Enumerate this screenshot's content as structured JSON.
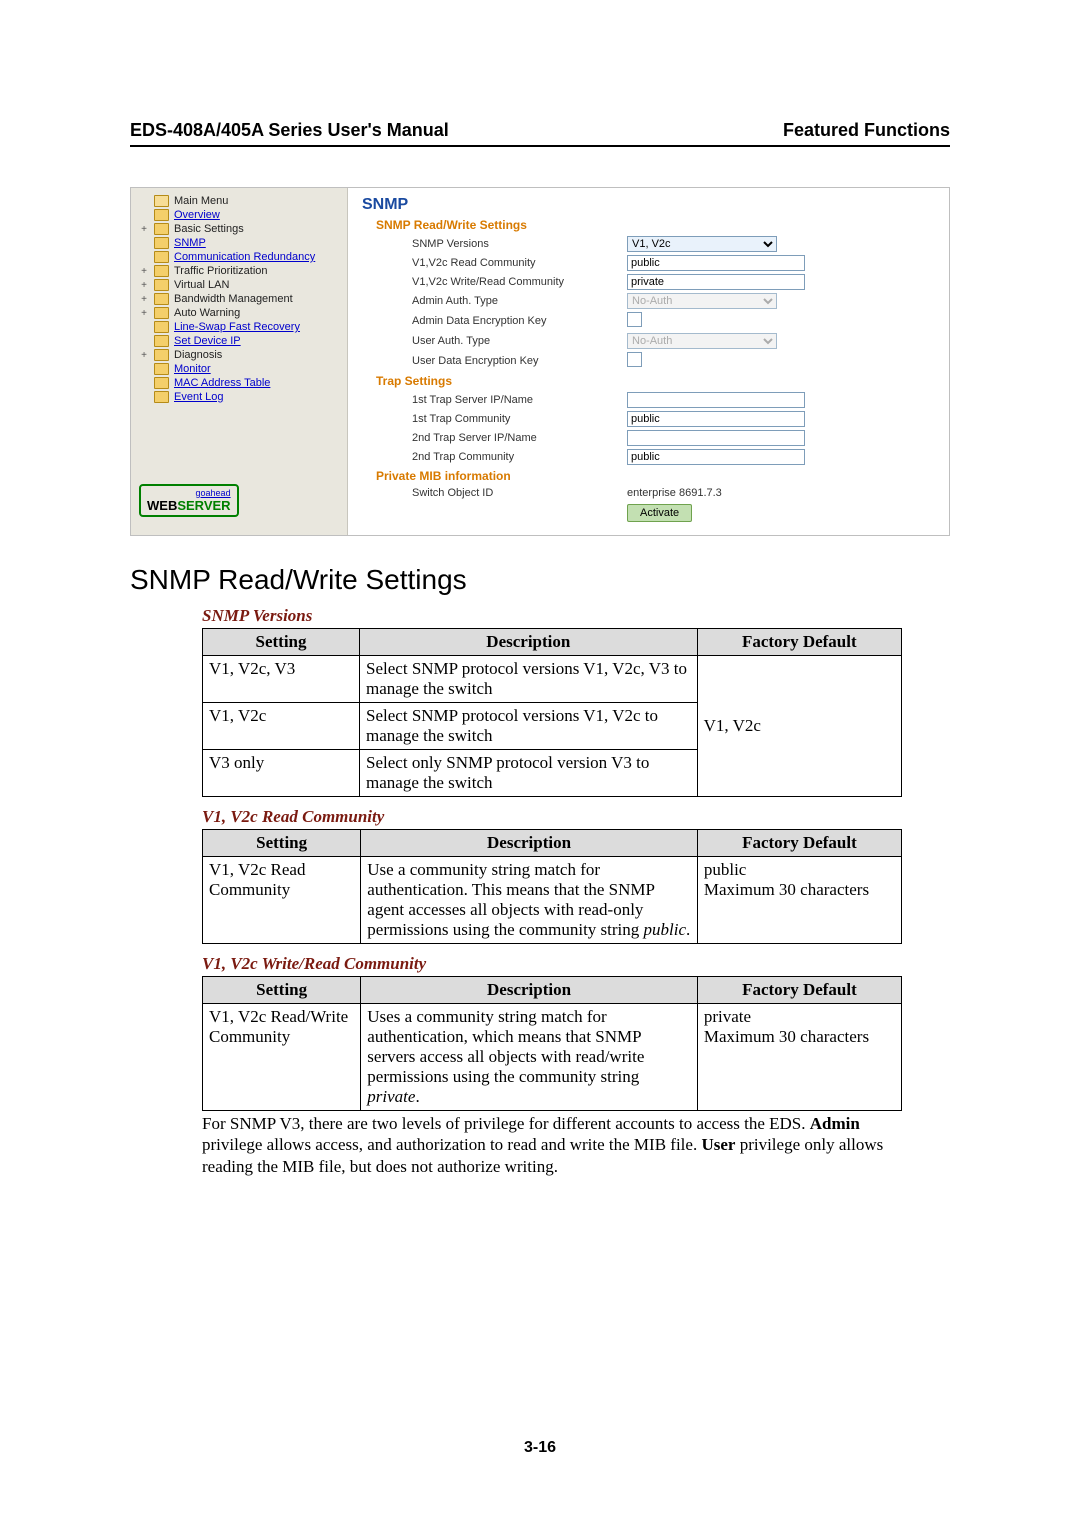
{
  "header": {
    "left": "EDS-408A/405A Series User's Manual",
    "right": "Featured Functions"
  },
  "screenshot": {
    "nav": {
      "root": "Main Menu",
      "items": [
        {
          "label": "Overview",
          "link": true
        },
        {
          "label": "Basic Settings",
          "exp": "+",
          "link": false
        },
        {
          "label": "SNMP",
          "link": true,
          "active": true
        },
        {
          "label": "Communication Redundancy",
          "link": true
        },
        {
          "label": "Traffic Prioritization",
          "exp": "+",
          "link": false
        },
        {
          "label": "Virtual LAN",
          "exp": "+",
          "link": false
        },
        {
          "label": "Bandwidth Management",
          "exp": "+",
          "link": false
        },
        {
          "label": "Auto Warning",
          "exp": "+",
          "link": false
        },
        {
          "label": "Line-Swap Fast Recovery",
          "link": true
        },
        {
          "label": "Set Device IP",
          "link": true
        },
        {
          "label": "Diagnosis",
          "exp": "+",
          "link": false
        },
        {
          "label": "Monitor",
          "link": true
        },
        {
          "label": "MAC Address Table",
          "link": true
        },
        {
          "label": "Event Log",
          "link": true
        }
      ],
      "badge": {
        "goahead": "goahead",
        "web": "WEB",
        "server": "SERVER"
      }
    },
    "main": {
      "title": "SNMP",
      "sect_rw": "SNMP Read/Write Settings",
      "rows": [
        {
          "label": "SNMP Versions",
          "type": "select",
          "value": "V1, V2c"
        },
        {
          "label": "V1,V2c Read Community",
          "type": "text",
          "value": "public"
        },
        {
          "label": "V1,V2c Write/Read Community",
          "type": "text",
          "value": "private"
        },
        {
          "label": "Admin Auth. Type",
          "type": "select-dis",
          "value": "No-Auth"
        },
        {
          "label": "Admin Data Encryption Key",
          "type": "check"
        },
        {
          "label": "User Auth. Type",
          "type": "select-dis",
          "value": "No-Auth"
        },
        {
          "label": "User Data Encryption Key",
          "type": "check"
        }
      ],
      "sect_trap": "Trap Settings",
      "trap_rows": [
        {
          "label": "1st Trap Server IP/Name",
          "type": "text",
          "value": ""
        },
        {
          "label": "1st Trap Community",
          "type": "text",
          "value": "public"
        },
        {
          "label": "2nd Trap Server IP/Name",
          "type": "text",
          "value": ""
        },
        {
          "label": "2nd Trap Community",
          "type": "text",
          "value": "public"
        }
      ],
      "sect_mib": "Private MIB information",
      "mib_label": "Switch Object ID",
      "mib_value": "enterprise 8691.7.3",
      "activate": "Activate"
    }
  },
  "body": {
    "h2": "SNMP Read/Write Settings",
    "t1": {
      "caption": "SNMP Versions",
      "head": {
        "c1": "Setting",
        "c2": "Description",
        "c3": "Factory Default"
      },
      "rows": [
        {
          "s": "V1, V2c, V3",
          "d": "Select SNMP protocol versions V1, V2c, V3 to manage the switch"
        },
        {
          "s": "V1, V2c",
          "d": "Select SNMP protocol versions V1, V2c to manage the switch"
        },
        {
          "s": "V3 only",
          "d": "Select only SNMP protocol version V3 to manage the switch"
        }
      ],
      "default": "V1, V2c"
    },
    "t2": {
      "caption": "V1, V2c Read Community",
      "head": {
        "c1": "Setting",
        "c2": "Description",
        "c3": "Factory Default"
      },
      "row": {
        "s": "V1, V2c Read Community",
        "d_pre": "Use a community string match for authentication. This means that the SNMP agent accesses all objects with read-only permissions using the community string ",
        "d_em": "public",
        "d_post": ".",
        "def_l1": "public",
        "def_l2": "Maximum 30 characters"
      }
    },
    "t3": {
      "caption": "V1, V2c Write/Read Community",
      "head": {
        "c1": "Setting",
        "c2": "Description",
        "c3": "Factory Default"
      },
      "row": {
        "s": "V1, V2c Read/Write Community",
        "d_pre": "Uses a community string match for authentication, which means that SNMP servers access all objects with read/write permissions using the community string ",
        "d_em": "private",
        "d_post": ".",
        "def_l1": "private",
        "def_l2": "Maximum 30 characters"
      }
    },
    "para_pre": "For SNMP V3, there are two levels of privilege for different accounts to access the EDS. ",
    "para_b1": "Admin",
    "para_mid": " privilege allows access, and authorization to read and write the MIB file. ",
    "para_b2": "User",
    "para_post": " privilege only allows reading the MIB file, but does not authorize writing.",
    "footer": "3-16"
  }
}
